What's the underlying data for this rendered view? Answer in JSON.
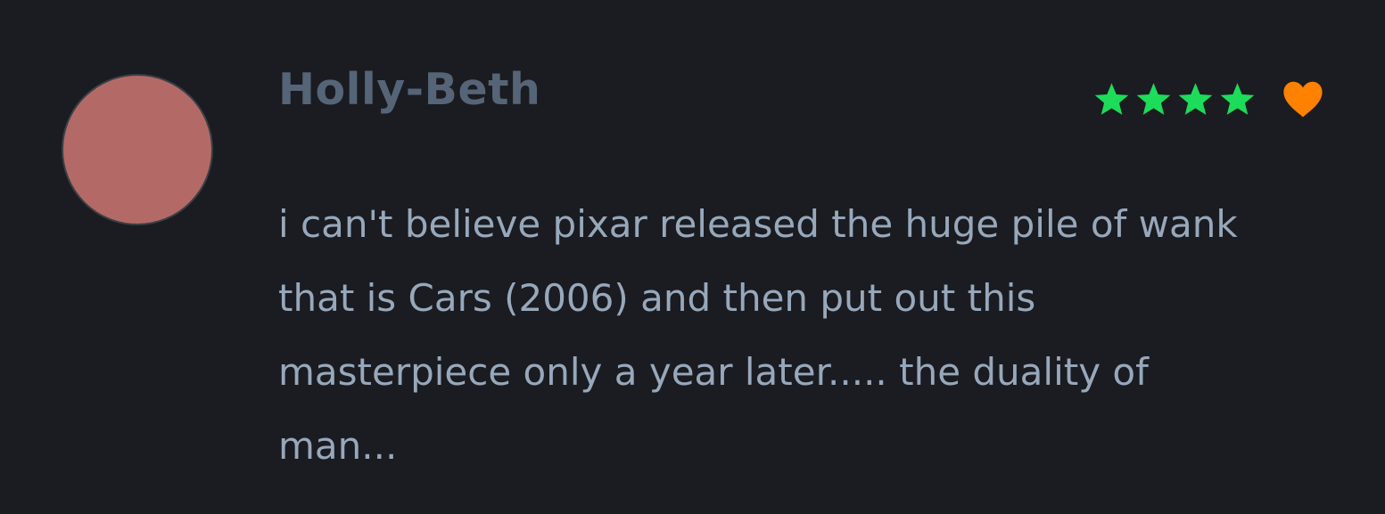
{
  "review": {
    "author": "Holly-Beth",
    "rating": 4,
    "rating_max": 5,
    "liked": true,
    "text": "i can't believe pixar released the huge pile of wank that is Cars (2006) and then put out this masterpiece only a year later..... the duality of man..."
  },
  "icons": {
    "star": "star-icon",
    "heart": "heart-icon"
  },
  "colors": {
    "background": "#1a1c21",
    "avatar": "#b36a66",
    "author": "#556577",
    "star": "#1ddc5a",
    "heart": "#fe8100",
    "text": "#98a8bb"
  }
}
